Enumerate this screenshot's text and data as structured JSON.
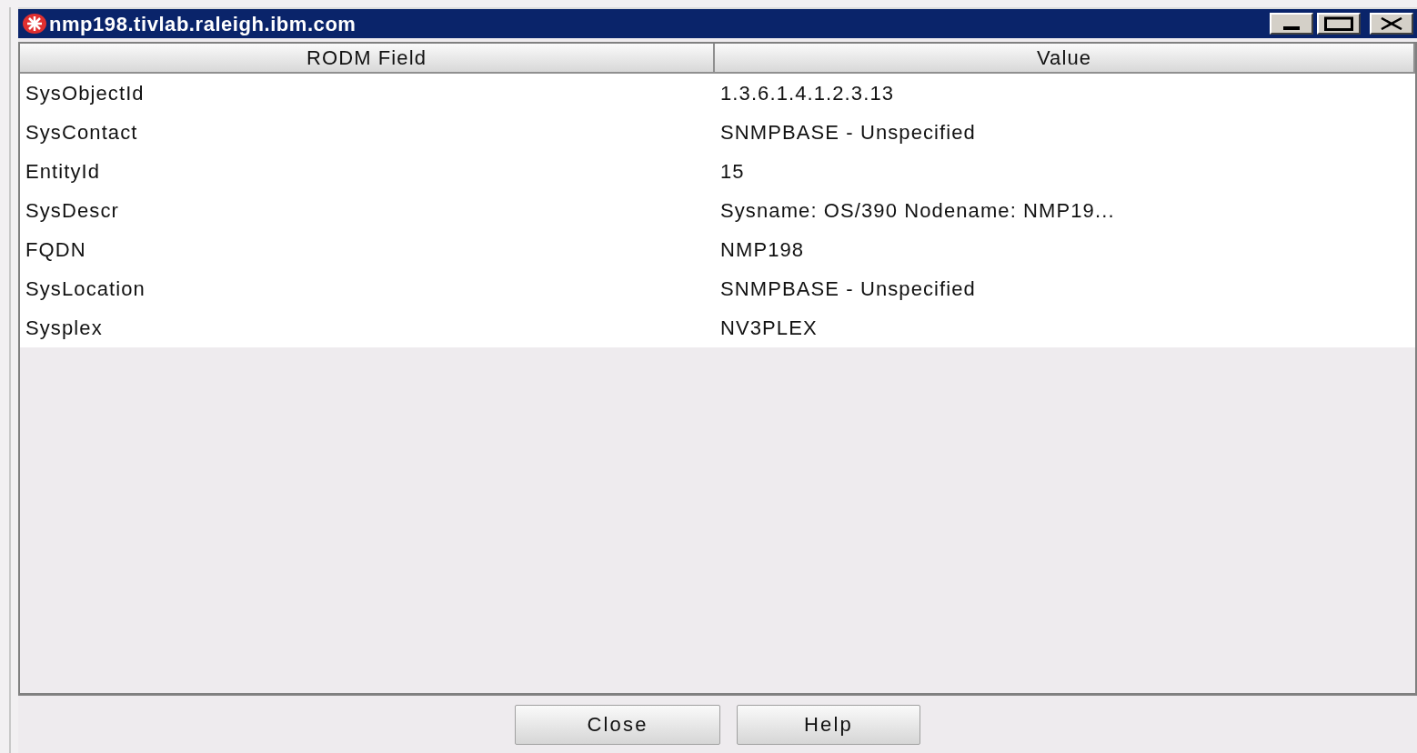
{
  "window": {
    "title": "nmp198.tivlab.raleigh.ibm.com"
  },
  "table": {
    "columns": [
      "RODM Field",
      "Value"
    ],
    "rows": [
      [
        "SysObjectId",
        "1.3.6.1.4.1.2.3.13"
      ],
      [
        "SysContact",
        "SNMPBASE - Unspecified"
      ],
      [
        "EntityId",
        "15"
      ],
      [
        "SysDescr",
        "Sysname: OS/390 Nodename: NMP19..."
      ],
      [
        "FQDN",
        "NMP198"
      ],
      [
        "SysLocation",
        "SNMPBASE - Unspecified"
      ],
      [
        "Sysplex",
        "NV3PLEX"
      ]
    ]
  },
  "buttons": [
    "Close",
    "Help"
  ]
}
